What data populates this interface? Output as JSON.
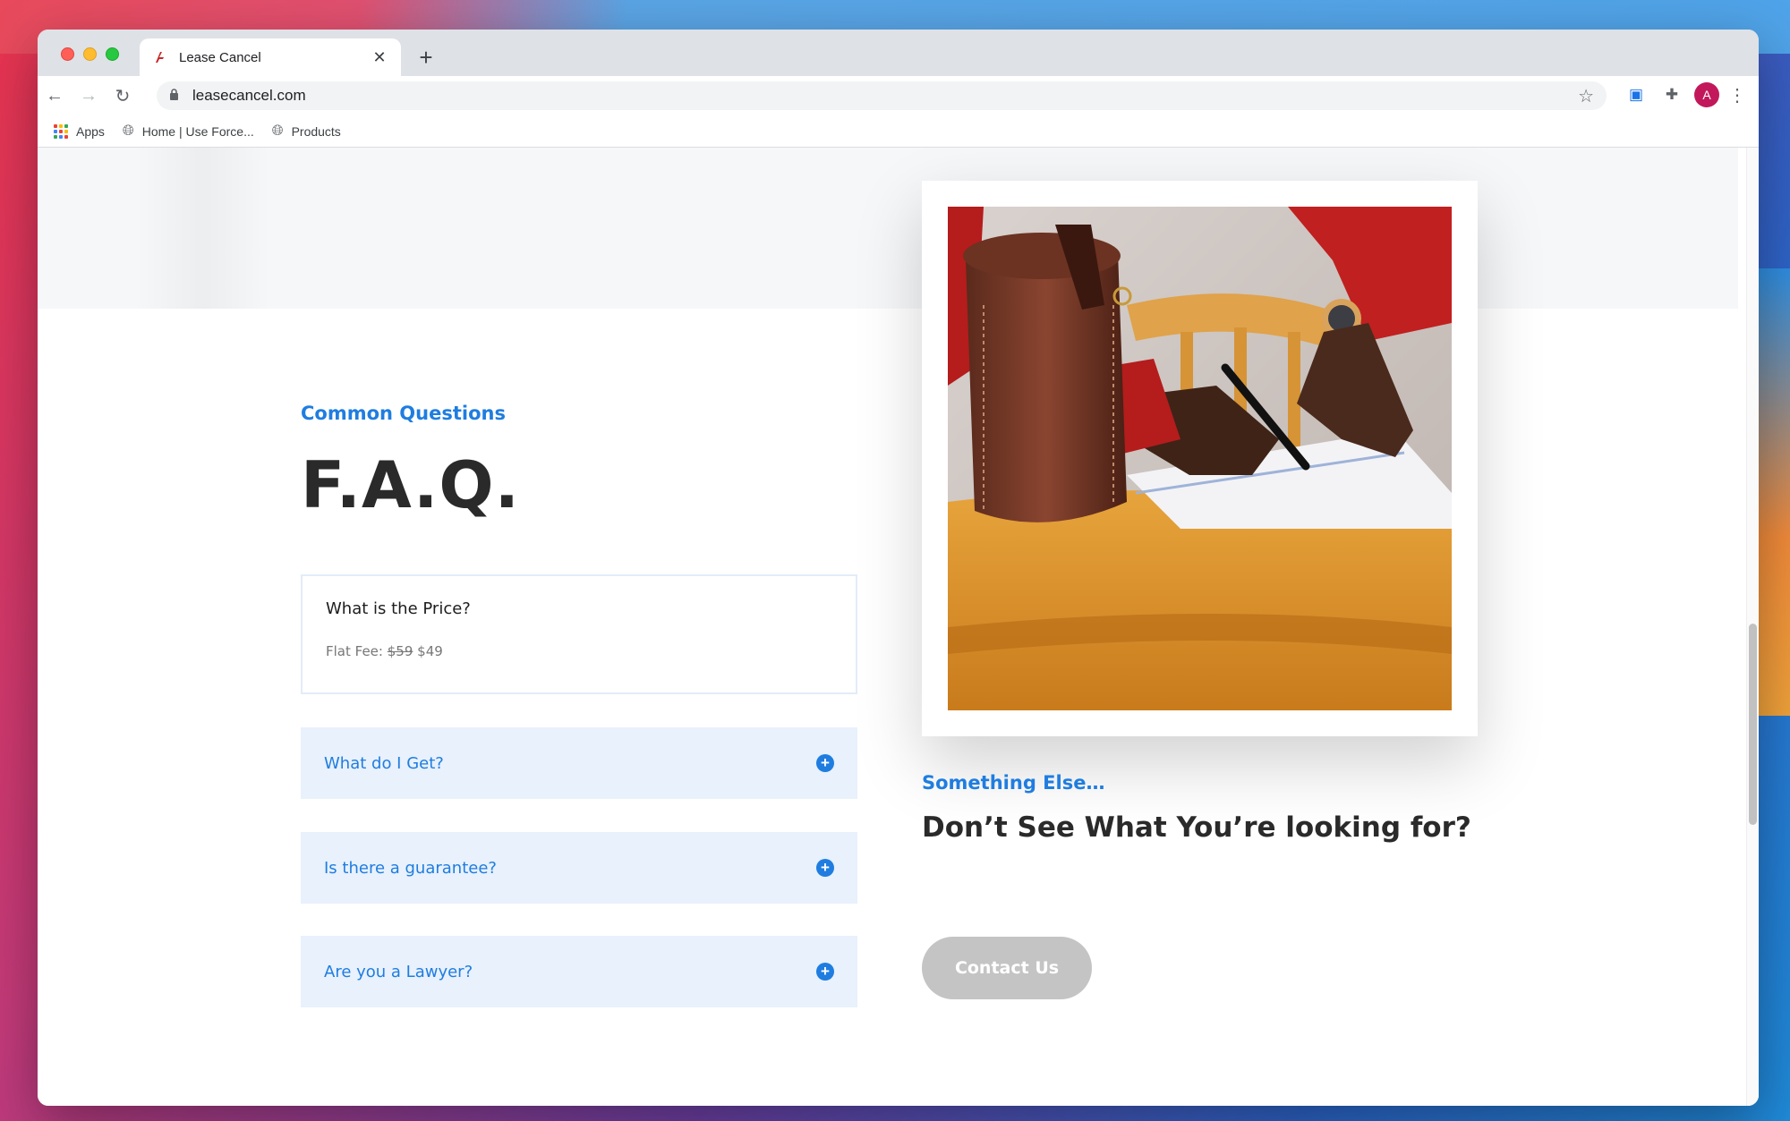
{
  "browser": {
    "tab_title": "Lease Cancel",
    "new_tab_label": "+",
    "url": "leasecancel.com",
    "avatar_initial": "A",
    "bookmarks": [
      {
        "label": "Apps"
      },
      {
        "label": "Home | Use Force..."
      },
      {
        "label": "Products"
      }
    ]
  },
  "faq": {
    "eyebrow": "Common Questions",
    "title": "F.A.Q.",
    "open_item": {
      "question": "What is the Price?",
      "answer_prefix": "Flat Fee:",
      "old_price": "$59",
      "new_price": "$49"
    },
    "items": [
      {
        "question": "What do I Get?"
      },
      {
        "question": "Is there a guarantee?"
      },
      {
        "question": "Are you a Lawyer?"
      }
    ]
  },
  "cta": {
    "eyebrow": "Something Else…",
    "title": "Don’t See What You’re looking for?",
    "button_label": "Contact Us"
  },
  "colors": {
    "accent": "#1f7de0",
    "faq_item_bg": "#e8f1fc",
    "button_bg": "#c4c4c4"
  }
}
